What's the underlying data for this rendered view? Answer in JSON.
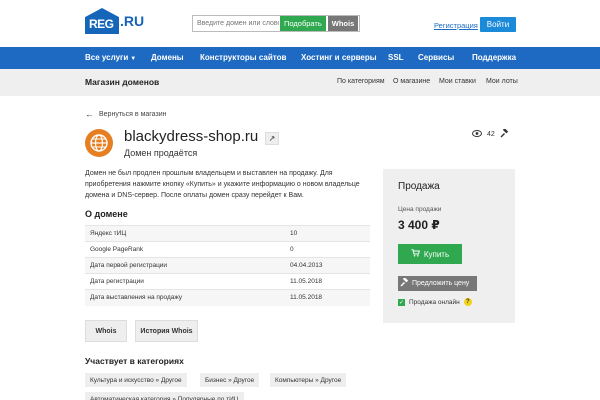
{
  "header": {
    "logo_main": "REG",
    "logo_suffix": ".RU",
    "search_placeholder": "Введите домен или слово",
    "pick_button": "Подобрать",
    "whois_button": "Whois",
    "register_link": "Регистрация",
    "login_button": "Войти"
  },
  "nav": {
    "items": [
      {
        "label": "Все услуги",
        "icon": "caret-down-icon"
      },
      {
        "label": "Домены"
      },
      {
        "label": "Конструкторы сайтов"
      },
      {
        "label": "Хостинг и серверы"
      },
      {
        "label": "SSL"
      },
      {
        "label": "Сервисы"
      },
      {
        "label": "Поддержка"
      }
    ]
  },
  "subheader": {
    "title": "Магазин доменов",
    "links": [
      "По категориям",
      "О магазине",
      "Мои ставки",
      "Мои лоты"
    ]
  },
  "back_link": "Вернуться в магазин",
  "domain": {
    "name": "blackydress-shop.ru",
    "status": "Домен продаётся",
    "views": "42",
    "description": "Домен не был продлен прошлым владельцем и выставлен на продажу. Для приобретения нажмите кнопку «Купить» и укажите информацию о новом владельце домена и DNS-сервер. После оплаты домен сразу перейдет к Вам."
  },
  "about": {
    "title": "О домене",
    "rows": [
      {
        "label": "Яндекс тИЦ",
        "value": "10"
      },
      {
        "label": "Google PageRank",
        "value": "0"
      },
      {
        "label": "Дата первой регистрации",
        "value": "04.04.2013"
      },
      {
        "label": "Дата регистрации",
        "value": "11.05.2018"
      },
      {
        "label": "Дата выставления на продажу",
        "value": "11.05.2018"
      }
    ]
  },
  "buttons": {
    "whois": "Whois",
    "whois_history": "История Whois"
  },
  "categories": {
    "title": "Участвует в категориях",
    "items": [
      "Культура и искусство » Другое",
      "Бизнес » Другое",
      "Компьютеры » Другое",
      "Автоматическая категория » Популярные по тИЦ"
    ]
  },
  "sale": {
    "title": "Продажа",
    "price_label": "Цена продажи",
    "price": "3 400 ₽",
    "buy_button": "Купить",
    "offer_button": "Предложить цену",
    "online_label": "Продажа онлайн",
    "help": "?"
  },
  "colors": {
    "brand_blue": "#1e69c2",
    "green": "#2fa84f",
    "orange": "#e67e22"
  }
}
